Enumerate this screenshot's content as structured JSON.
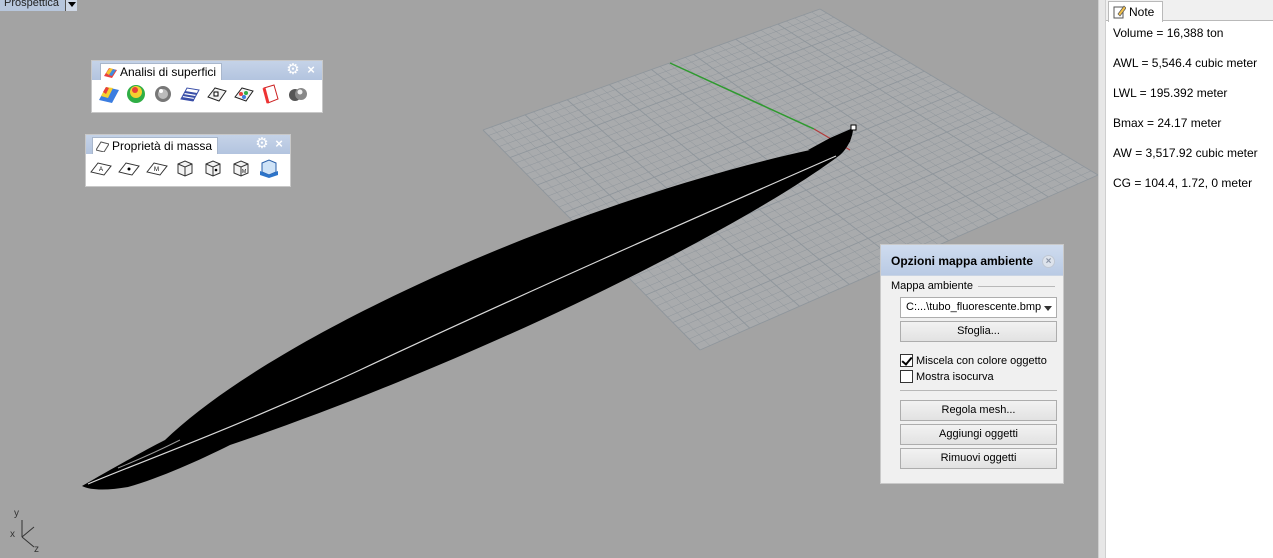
{
  "viewport": {
    "title": "Prospettica",
    "axes": {
      "x": "x",
      "y": "y",
      "z": "z"
    }
  },
  "toolbars": [
    {
      "title": "Analisi di superfici",
      "icons": [
        "curvature-analysis-icon",
        "draft-angle-icon",
        "environment-map-icon",
        "zebra-icon",
        "surface-analysis-icon",
        "points-analysis-icon",
        "edge-analysis-icon",
        "render-analysis-icon"
      ]
    },
    {
      "title": "Proprietà di massa",
      "icons": [
        "area-icon",
        "area-centroid-icon",
        "area-moments-icon",
        "volume-icon",
        "volume-centroid-icon",
        "volume-moments-icon",
        "hydrostatics-icon"
      ]
    }
  ],
  "env_panel": {
    "title": "Opzioni mappa ambiente",
    "group_label": "Mappa ambiente",
    "map_file": "C:...\\tubo_fluorescente.bmp",
    "browse": "Sfoglia...",
    "blend_label": "Miscela con colore oggetto",
    "blend_checked": true,
    "isocurve_label": "Mostra isocurva",
    "isocurve_checked": false,
    "mesh_button": "Regola mesh...",
    "add_button": "Aggiungi oggetti",
    "remove_button": "Rimuovi oggetti"
  },
  "notes": {
    "tab": "Note",
    "lines": [
      "Volume = 16,388 ton",
      "AWL = 5,546.4 cubic meter",
      "LWL = 195.392 meter",
      "Bmax = 24.17 meter",
      "AW = 3,517.92 cubic meter",
      "CG = 104.4, 1.72, 0 meter"
    ]
  },
  "colors": {
    "viewport_bg": "#a3a3a3",
    "grid_line": "#8f969c",
    "axis_green": "#2f9a2f",
    "axis_red": "#b23a3a",
    "hull": "#000000",
    "panel_header": "#b9cae4"
  }
}
